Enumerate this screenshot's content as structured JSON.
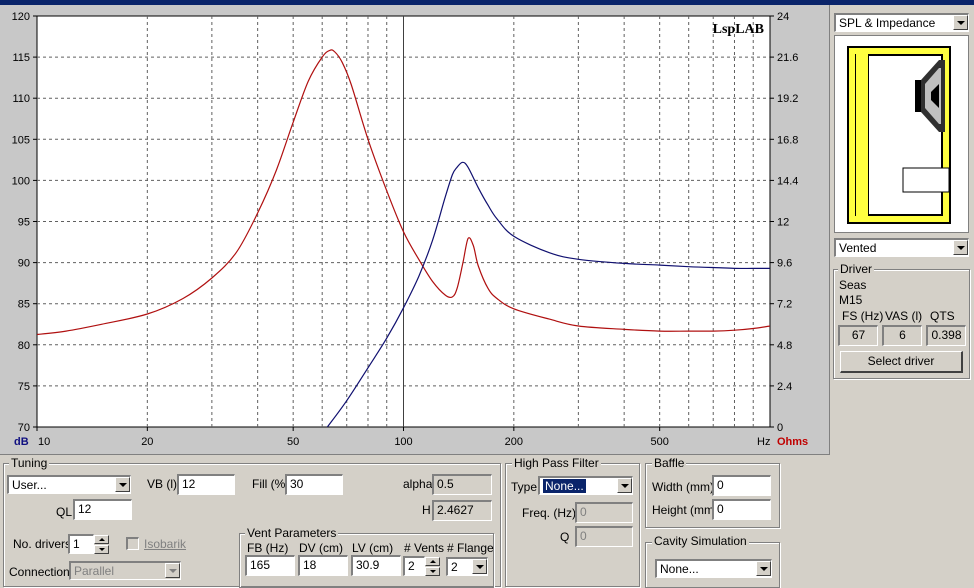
{
  "chart_data": {
    "type": "line",
    "watermark": "LspLAB",
    "x_scale": "log",
    "xlim": [
      10,
      1000
    ],
    "x_ticks": [
      {
        "value": 10,
        "label": "10"
      },
      {
        "value": 20,
        "label": "20"
      },
      {
        "value": 50,
        "label": "50"
      },
      {
        "value": 100,
        "label": "100"
      },
      {
        "value": 200,
        "label": "200"
      },
      {
        "value": 500,
        "label": "500"
      }
    ],
    "x_unit": "Hz",
    "y_left_unit": "dB",
    "y_right_unit": "Ohms",
    "y_left_lim": [
      70,
      120
    ],
    "y_left_ticks": [
      "70",
      "75",
      "80",
      "85",
      "90",
      "95",
      "100",
      "105",
      "110",
      "115",
      "120"
    ],
    "y_right_lim": [
      0,
      24
    ],
    "y_right_ticks": [
      "0",
      "2.4",
      "4.8",
      "7.2",
      "9.6",
      "12",
      "14.4",
      "16.8",
      "19.2",
      "21.6",
      "24"
    ],
    "grid": true,
    "marker_x": 100,
    "series": [
      {
        "axis": "right",
        "color": "#b01010",
        "x": [
          10,
          12,
          15,
          20,
          25,
          30,
          35,
          40,
          45,
          50,
          55,
          60,
          63,
          65,
          68,
          72,
          80,
          90,
          100,
          110,
          120,
          130,
          136,
          140,
          145,
          150,
          155,
          160,
          170,
          180,
          200,
          250,
          300,
          400,
          500,
          600,
          700,
          800,
          900,
          1000
        ],
        "y": [
          5.4,
          5.6,
          6.0,
          6.6,
          7.5,
          8.7,
          10.2,
          12.5,
          15.0,
          17.8,
          20.2,
          21.6,
          22.0,
          21.9,
          21.3,
          20.0,
          16.8,
          13.8,
          11.4,
          9.8,
          8.5,
          7.7,
          7.6,
          8.1,
          9.5,
          11.0,
          10.6,
          9.4,
          8.1,
          7.5,
          6.9,
          6.3,
          5.9,
          5.7,
          5.6,
          5.6,
          5.6,
          5.65,
          5.75,
          5.9
        ]
      },
      {
        "axis": "left",
        "color": "#101070",
        "x": [
          62,
          70,
          80,
          90,
          100,
          110,
          120,
          130,
          136,
          140,
          145,
          150,
          160,
          170,
          180,
          200,
          250,
          300,
          400,
          500,
          600,
          700,
          800,
          900,
          1000
        ],
        "y": [
          70,
          73.2,
          77.2,
          80.8,
          84.5,
          88.3,
          92.7,
          98.0,
          100.7,
          101.6,
          102.2,
          101.6,
          99.1,
          97.0,
          95.3,
          93.2,
          91.2,
          90.4,
          89.9,
          89.7,
          89.5,
          89.4,
          89.3,
          89.3,
          89.3
        ]
      }
    ]
  },
  "side": {
    "view_select": "SPL & Impedance",
    "enclosure_select": "Vented",
    "driver_group": "Driver",
    "driver_brand": "Seas",
    "driver_model": "M15",
    "fs_label": "FS (Hz)",
    "vas_label": "VAS (l)",
    "qts_label": "QTS",
    "fs_value": "67",
    "vas_value": "6",
    "qts_value": "0.398",
    "select_driver": "Select driver"
  },
  "tuning": {
    "title": "Tuning",
    "preset": "User...",
    "vb_label": "VB (l)",
    "vb_value": "12",
    "fill_label": "Fill (%)",
    "fill_value": "30",
    "alpha_label": "alpha",
    "alpha_value": "0.5",
    "ql_label": "QL",
    "ql_value": "12",
    "h_label": "H",
    "h_value": "2.4627",
    "drivers_label": "No. drivers",
    "drivers_value": "1",
    "isobarik_label": "Isobarik",
    "connection_label": "Connection",
    "connection_value": "Parallel"
  },
  "vent": {
    "title": "Vent Parameters",
    "fb_label": "FB (Hz)",
    "dv_label": "DV (cm)",
    "lv_label": "LV (cm)",
    "vents_label": "# Vents",
    "flange_label": "# Flange",
    "fb_value": "165",
    "dv_value": "18",
    "lv_value": "30.9",
    "vents_value": "2",
    "flange_value": "2"
  },
  "hpf": {
    "title": "High Pass Filter",
    "type_label": "Type",
    "type_value": "None...",
    "freq_label": "Freq. (Hz)",
    "freq_value": "0",
    "q_label": "Q",
    "q_value": "0"
  },
  "baffle": {
    "title": "Baffle",
    "width_label": "Width (mm)",
    "width_value": "0",
    "height_label": "Height (mm)",
    "height_value": "0"
  },
  "cavity": {
    "title": "Cavity Simulation",
    "value": "None..."
  }
}
